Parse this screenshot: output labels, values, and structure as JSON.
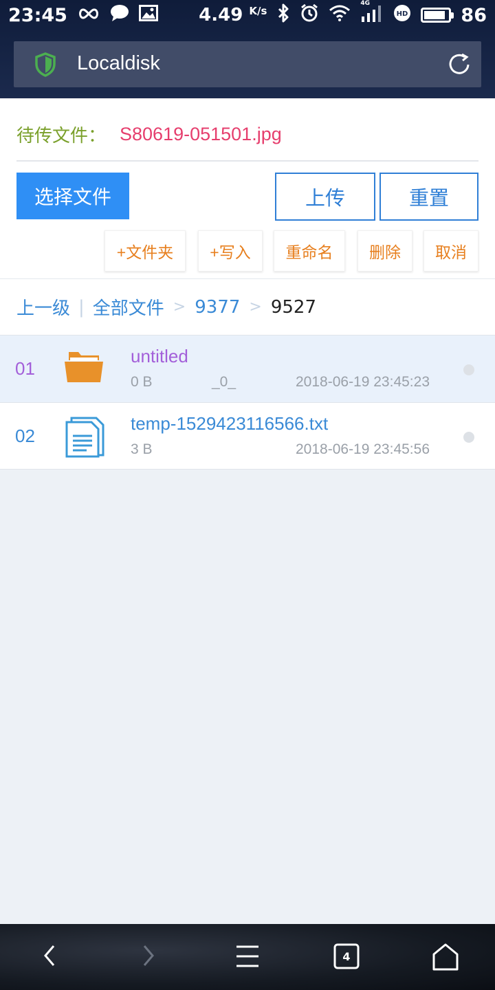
{
  "status_bar": {
    "time": "23:45",
    "speed_value": "4.49",
    "speed_unit": "K/s",
    "network": "4G",
    "battery_level": "86",
    "battery_fraction": 0.86
  },
  "browser": {
    "title": "Localdisk",
    "tab_count": "4"
  },
  "upload": {
    "pending_label": "待传文件：",
    "pending_file": "S80619-051501.jpg",
    "choose_label": "选择文件",
    "upload_label": "上传",
    "reset_label": "重置"
  },
  "actions": {
    "new_folder": "+文件夹",
    "write": "+写入",
    "rename": "重命名",
    "delete": "删除",
    "cancel": "取消"
  },
  "breadcrumb": {
    "up": "上一级",
    "separator": "|",
    "all_files": "全部文件",
    "arrow": ">",
    "dir1": "9377",
    "current": "9527"
  },
  "files": [
    {
      "index": "01",
      "name": "untitled",
      "size": "0 B",
      "extra": "_0_",
      "time": "2018-06-19 23:45:23",
      "icon": "folder-icon"
    },
    {
      "index": "02",
      "name": "temp-1529423116566.txt",
      "size": "3 B",
      "extra": "",
      "time": "2018-06-19 23:45:56",
      "icon": "document-icon"
    }
  ],
  "colors": {
    "accent": "#2f8ff5",
    "outline": "#2f7fd6",
    "pending_label": "#7aa02b",
    "pending_file": "#e63e6d",
    "action_text": "#e77f1e",
    "folder": "#e8912a",
    "selected_row": "#e9f1fb"
  }
}
